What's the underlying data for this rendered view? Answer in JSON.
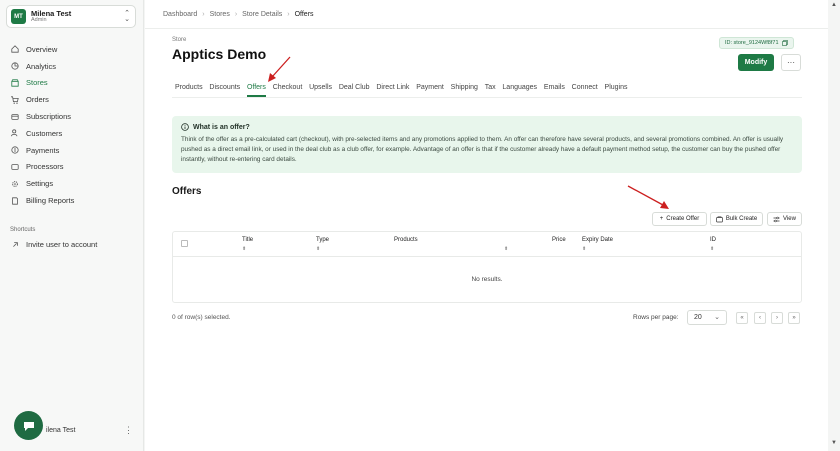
{
  "account": {
    "initials": "MT",
    "name": "Milena Test",
    "role": "Admin"
  },
  "nav": [
    {
      "label": "Overview",
      "icon": "home-icon"
    },
    {
      "label": "Analytics",
      "icon": "analytics-icon"
    },
    {
      "label": "Stores",
      "icon": "store-icon",
      "active": true
    },
    {
      "label": "Orders",
      "icon": "cart-icon"
    },
    {
      "label": "Subscriptions",
      "icon": "subscription-icon"
    },
    {
      "label": "Customers",
      "icon": "customers-icon"
    },
    {
      "label": "Payments",
      "icon": "payments-icon"
    },
    {
      "label": "Processors",
      "icon": "processors-icon"
    },
    {
      "label": "Settings",
      "icon": "gear-icon"
    },
    {
      "label": "Billing Reports",
      "icon": "report-icon"
    }
  ],
  "shortcuts": {
    "label": "Shortcuts",
    "item": "Invite user to account"
  },
  "footer": {
    "user": "ilena Test"
  },
  "breadcrumb": [
    "Dashboard",
    "Stores",
    "Store Details",
    "Offers"
  ],
  "store": {
    "label": "Store",
    "title": "Apptics Demo",
    "id": "ID: store_9124Wf8f71"
  },
  "actions": {
    "modify": "Modify",
    "more": "···"
  },
  "tabs": [
    "Products",
    "Discounts",
    "Offers",
    "Checkout",
    "Upsells",
    "Deal Club",
    "Direct Link",
    "Payment",
    "Shipping",
    "Tax",
    "Languages",
    "Emails",
    "Connect",
    "Plugins"
  ],
  "active_tab": "Offers",
  "info": {
    "heading": "What is an offer?",
    "body": "Think of the offer as a pre-calculated cart (checkout), with pre-selected items and any promotions applied to them. An offer can therefore have several products, and several promotions combined. An offer is usually pushed as a direct email link, or used in the deal club as a club offer, for example. Advantage of an offer is that if the customer already have a default payment method setup, the customer can buy the pushed offer instantly, without re-entering card details."
  },
  "offers": {
    "title": "Offers",
    "create_label": "Create Offer",
    "bulk_label": "Bulk Create",
    "view_label": "View",
    "columns": [
      "Title",
      "Type",
      "Products",
      "Price",
      "Expiry Date",
      "ID"
    ],
    "empty": "No results."
  },
  "footer_bar": {
    "selected": "0 of row(s) selected.",
    "rows_label": "Rows per page:",
    "rows_value": "20"
  },
  "colors": {
    "accent": "#1e7a45",
    "annotation": "#cc1f1f"
  }
}
